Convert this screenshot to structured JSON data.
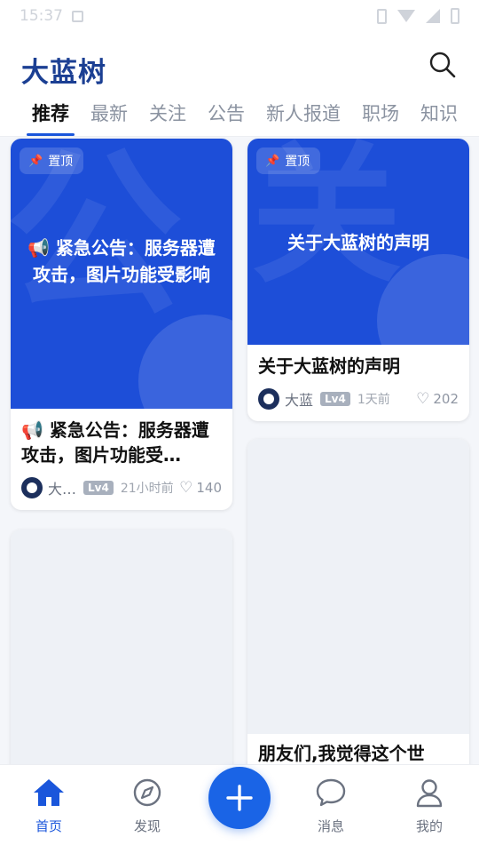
{
  "status_bar": {
    "time": "15:37"
  },
  "header": {
    "title": "大蓝树",
    "tabs": [
      "推荐",
      "最新",
      "关注",
      "公告",
      "新人报道",
      "职场",
      "知识"
    ],
    "active_tab": "推荐"
  },
  "cards": [
    {
      "pin_label": "置顶",
      "cover_text": "📢 紧急公告：服务器遭攻击，图片功能受影响",
      "cover_watermark": "公",
      "title": "📢 紧急公告：服务器遭攻击，图片功能受…",
      "author": "大…",
      "level": "Lv4",
      "time": "21小时前",
      "likes": "140"
    },
    {
      "pin_label": "置顶",
      "cover_text": "关于大蓝树的声明",
      "cover_watermark": "关",
      "title": "关于大蓝树的声明",
      "author": "大蓝",
      "level": "Lv4",
      "time": "1天前",
      "likes": "202"
    },
    {
      "title": "朋友们,我觉得这个世"
    }
  ],
  "bottom_nav": {
    "items": [
      {
        "label": "首页",
        "icon": "home-icon",
        "active": true
      },
      {
        "label": "发现",
        "icon": "compass-icon",
        "active": false
      },
      {
        "label": "消息",
        "icon": "message-icon",
        "active": false
      },
      {
        "label": "我的",
        "icon": "user-icon",
        "active": false
      }
    ],
    "fab_icon": "plus-icon"
  },
  "colors": {
    "brand": "#1b3f93",
    "accent": "#1a56db",
    "cover_blue": "#1d4ed8"
  }
}
